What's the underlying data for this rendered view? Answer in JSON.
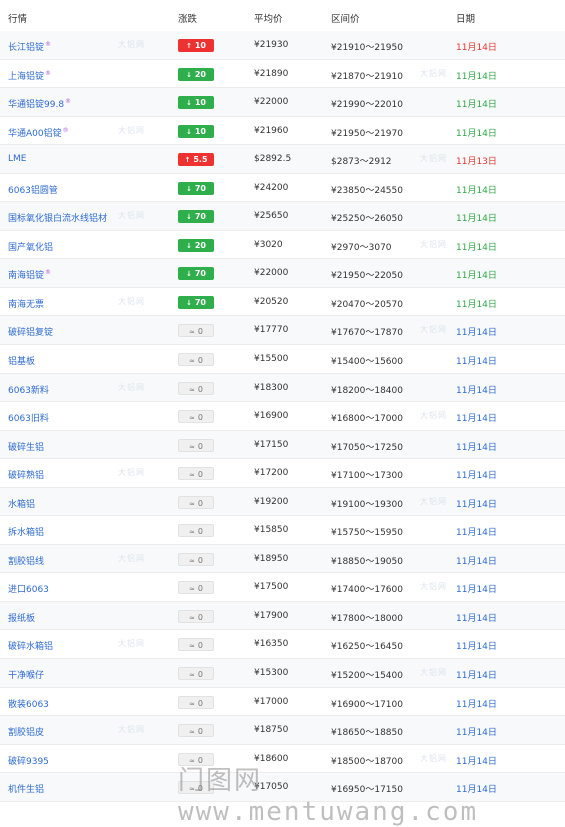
{
  "header": {
    "name": "行情",
    "change": "涨跌",
    "avg": "平均价",
    "range": "区间价",
    "date": "日期"
  },
  "rows": [
    {
      "name": "长江铝锭",
      "mark": "®",
      "dir": "up",
      "arrow": "↑",
      "change": "10",
      "avg": "¥21930",
      "range": "¥21910～21950",
      "date": "11月14日",
      "date_color": "red"
    },
    {
      "name": "上海铝锭",
      "mark": "®",
      "dir": "down",
      "arrow": "↓",
      "change": "20",
      "avg": "¥21890",
      "range": "¥21870～21910",
      "date": "11月14日",
      "date_color": "green"
    },
    {
      "name": "华通铝锭99.8",
      "mark": "®",
      "dir": "down",
      "arrow": "↓",
      "change": "10",
      "avg": "¥22000",
      "range": "¥21990～22010",
      "date": "11月14日",
      "date_color": "green"
    },
    {
      "name": "华通A00铝锭",
      "mark": "®",
      "dir": "down",
      "arrow": "↓",
      "change": "10",
      "avg": "¥21960",
      "range": "¥21950～21970",
      "date": "11月14日",
      "date_color": "green"
    },
    {
      "name": "LME",
      "mark": "",
      "dir": "up",
      "arrow": "↑",
      "change": "5.5",
      "avg": "$2892.5",
      "range": "$2873～2912",
      "date": "11月13日",
      "date_color": "red"
    },
    {
      "name": "6063铝圆管",
      "mark": "",
      "dir": "down",
      "arrow": "↓",
      "change": "70",
      "avg": "¥24200",
      "range": "¥23850～24550",
      "date": "11月14日",
      "date_color": "green"
    },
    {
      "name": "国标氧化银白流水线铝材",
      "mark": "",
      "dir": "down",
      "arrow": "↓",
      "change": "70",
      "avg": "¥25650",
      "range": "¥25250～26050",
      "date": "11月14日",
      "date_color": "green"
    },
    {
      "name": "国产氧化铝",
      "mark": "",
      "dir": "down",
      "arrow": "↓",
      "change": "20",
      "avg": "¥3020",
      "range": "¥2970～3070",
      "date": "11月14日",
      "date_color": "green"
    },
    {
      "name": "南海铝锭",
      "mark": "®",
      "dir": "down",
      "arrow": "↓",
      "change": "70",
      "avg": "¥22000",
      "range": "¥21950～22050",
      "date": "11月14日",
      "date_color": "green"
    },
    {
      "name": "南海无票",
      "mark": "",
      "dir": "down",
      "arrow": "↓",
      "change": "70",
      "avg": "¥20520",
      "range": "¥20470～20570",
      "date": "11月14日",
      "date_color": "green"
    },
    {
      "name": "破碎铝复锭",
      "mark": "",
      "dir": "flat",
      "arrow": "≈",
      "change": "0",
      "avg": "¥17770",
      "range": "¥17670～17870",
      "date": "11月14日",
      "date_color": "blue"
    },
    {
      "name": "铝基板",
      "mark": "",
      "dir": "flat",
      "arrow": "≈",
      "change": "0",
      "avg": "¥15500",
      "range": "¥15400～15600",
      "date": "11月14日",
      "date_color": "blue"
    },
    {
      "name": "6063新料",
      "mark": "",
      "dir": "flat",
      "arrow": "≈",
      "change": "0",
      "avg": "¥18300",
      "range": "¥18200～18400",
      "date": "11月14日",
      "date_color": "blue"
    },
    {
      "name": "6063旧料",
      "mark": "",
      "dir": "flat",
      "arrow": "≈",
      "change": "0",
      "avg": "¥16900",
      "range": "¥16800～17000",
      "date": "11月14日",
      "date_color": "blue"
    },
    {
      "name": "破碎生铝",
      "mark": "",
      "dir": "flat",
      "arrow": "≈",
      "change": "0",
      "avg": "¥17150",
      "range": "¥17050～17250",
      "date": "11月14日",
      "date_color": "blue"
    },
    {
      "name": "破碎熟铝",
      "mark": "",
      "dir": "flat",
      "arrow": "≈",
      "change": "0",
      "avg": "¥17200",
      "range": "¥17100～17300",
      "date": "11月14日",
      "date_color": "blue"
    },
    {
      "name": "水箱铝",
      "mark": "",
      "dir": "flat",
      "arrow": "≈",
      "change": "0",
      "avg": "¥19200",
      "range": "¥19100～19300",
      "date": "11月14日",
      "date_color": "blue"
    },
    {
      "name": "拆水箱铝",
      "mark": "",
      "dir": "flat",
      "arrow": "≈",
      "change": "0",
      "avg": "¥15850",
      "range": "¥15750～15950",
      "date": "11月14日",
      "date_color": "blue"
    },
    {
      "name": "割胶铝线",
      "mark": "",
      "dir": "flat",
      "arrow": "≈",
      "change": "0",
      "avg": "¥18950",
      "range": "¥18850～19050",
      "date": "11月14日",
      "date_color": "blue"
    },
    {
      "name": "进口6063",
      "mark": "",
      "dir": "flat",
      "arrow": "≈",
      "change": "0",
      "avg": "¥17500",
      "range": "¥17400～17600",
      "date": "11月14日",
      "date_color": "blue"
    },
    {
      "name": "报纸板",
      "mark": "",
      "dir": "flat",
      "arrow": "≈",
      "change": "0",
      "avg": "¥17900",
      "range": "¥17800～18000",
      "date": "11月14日",
      "date_color": "blue"
    },
    {
      "name": "破碎水箱铝",
      "mark": "",
      "dir": "flat",
      "arrow": "≈",
      "change": "0",
      "avg": "¥16350",
      "range": "¥16250～16450",
      "date": "11月14日",
      "date_color": "blue"
    },
    {
      "name": "干净喉仔",
      "mark": "",
      "dir": "flat",
      "arrow": "≈",
      "change": "0",
      "avg": "¥15300",
      "range": "¥15200～15400",
      "date": "11月14日",
      "date_color": "blue"
    },
    {
      "name": "散装6063",
      "mark": "",
      "dir": "flat",
      "arrow": "≈",
      "change": "0",
      "avg": "¥17000",
      "range": "¥16900～17100",
      "date": "11月14日",
      "date_color": "blue"
    },
    {
      "name": "割胶铝皮",
      "mark": "",
      "dir": "flat",
      "arrow": "≈",
      "change": "0",
      "avg": "¥18750",
      "range": "¥18650～18850",
      "date": "11月14日",
      "date_color": "blue"
    },
    {
      "name": "破碎9395",
      "mark": "",
      "dir": "flat",
      "arrow": "≈",
      "change": "0",
      "avg": "¥18600",
      "range": "¥18500～18700",
      "date": "11月14日",
      "date_color": "blue"
    },
    {
      "name": "机件生铝",
      "mark": "",
      "dir": "flat",
      "arrow": "≈",
      "change": "0",
      "avg": "¥17050",
      "range": "¥16950～17150",
      "date": "11月14日",
      "date_color": "blue"
    }
  ],
  "colors": {
    "red": "#e8342b",
    "green": "#2fa845",
    "blue": "#2e6bd3",
    "link": "#2e6bd3"
  },
  "watermark": "门图网 www.mentuwang.com",
  "row_watermark": "大铝网"
}
